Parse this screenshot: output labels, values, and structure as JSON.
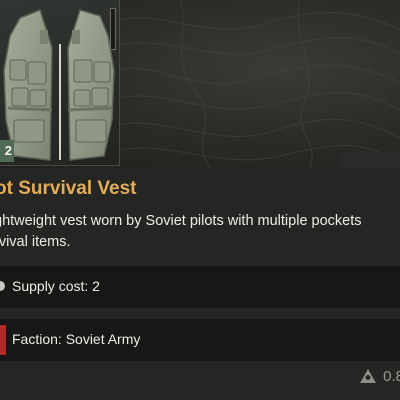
{
  "item": {
    "title": "ot Survival Vest",
    "description_lines": [
      "ghtweight vest worn by Soviet pilots with multiple pockets",
      "rvival items."
    ],
    "count": "2",
    "thumbnail_icon": "vest-icon"
  },
  "stats": {
    "supply": {
      "label": "Supply cost: 2",
      "icon": "supply-icon"
    },
    "faction": {
      "label": "Faction: Soviet Army",
      "icon": "faction-flag-icon",
      "color": "#b02a28"
    },
    "weight": {
      "value": "0.8",
      "icon": "weight-icon"
    }
  },
  "colors": {
    "title": "#e2ac58",
    "text": "#ecece6",
    "row_background": "#171716",
    "badge": "#4f6a55"
  }
}
